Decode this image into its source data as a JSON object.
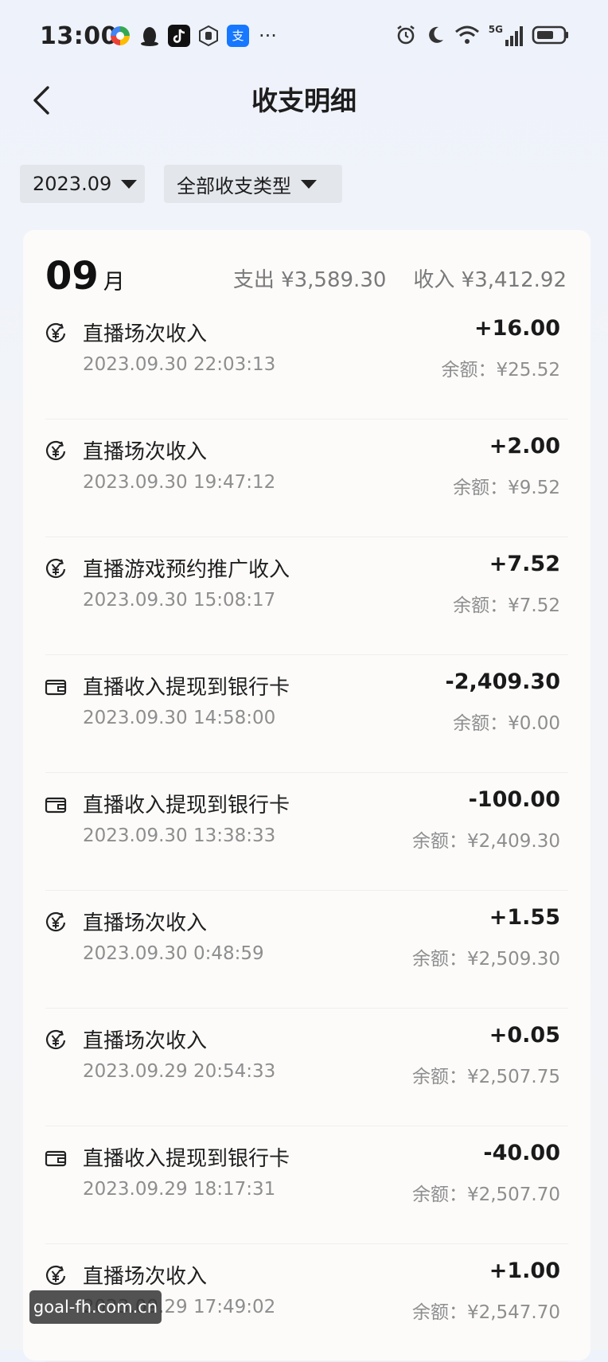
{
  "status_bar": {
    "time": "13:00",
    "left_icons": [
      "color-app-icon",
      "qq-penguin-icon",
      "tiktok-icon",
      "hand-badge-icon",
      "alipay-icon"
    ],
    "overflow": "···",
    "right_icons": [
      "alarm-icon",
      "moon-icon",
      "wifi-icon",
      "signal-5g-icon",
      "battery-icon"
    ],
    "network": "5G"
  },
  "header": {
    "title": "收支明细"
  },
  "filters": {
    "month": "2023.09",
    "type": "全部收支类型"
  },
  "summary": {
    "month_num": "09",
    "month_unit": "月",
    "expense": "支出 ¥3,589.30",
    "income": "收入 ¥3,412.92"
  },
  "transactions": [
    {
      "icon": "yuan-income-icon",
      "name": "直播场次收入",
      "amount": "+16.00",
      "time": "2023.09.30 22:03:13",
      "balance": "余额：¥25.52"
    },
    {
      "icon": "yuan-income-icon",
      "name": "直播场次收入",
      "amount": "+2.00",
      "time": "2023.09.30 19:47:12",
      "balance": "余额：¥9.52"
    },
    {
      "icon": "yuan-income-icon",
      "name": "直播游戏预约推广收入",
      "amount": "+7.52",
      "time": "2023.09.30 15:08:17",
      "balance": "余额：¥7.52"
    },
    {
      "icon": "wallet-icon",
      "name": "直播收入提现到银行卡",
      "amount": "-2,409.30",
      "time": "2023.09.30 14:58:00",
      "balance": "余额：¥0.00"
    },
    {
      "icon": "wallet-icon",
      "name": "直播收入提现到银行卡",
      "amount": "-100.00",
      "time": "2023.09.30 13:38:33",
      "balance": "余额：¥2,409.30"
    },
    {
      "icon": "yuan-income-icon",
      "name": "直播场次收入",
      "amount": "+1.55",
      "time": "2023.09.30 0:48:59",
      "balance": "余额：¥2,509.30"
    },
    {
      "icon": "yuan-income-icon",
      "name": "直播场次收入",
      "amount": "+0.05",
      "time": "2023.09.29 20:54:33",
      "balance": "余额：¥2,507.75"
    },
    {
      "icon": "wallet-icon",
      "name": "直播收入提现到银行卡",
      "amount": "-40.00",
      "time": "2023.09.29 18:17:31",
      "balance": "余额：¥2,507.70"
    },
    {
      "icon": "yuan-income-icon",
      "name": "直播场次收入",
      "amount": "+1.00",
      "time": "2023.09.29 17:49:02",
      "balance": "余额：¥2,547.70"
    }
  ],
  "watermark": "goal-fh.com.cn"
}
